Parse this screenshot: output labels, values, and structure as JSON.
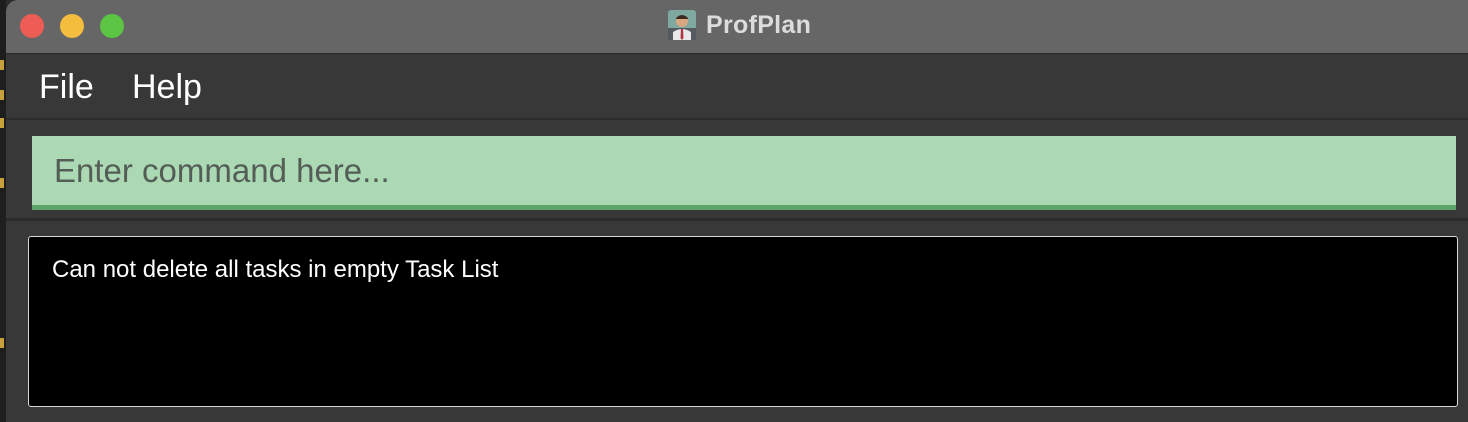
{
  "window": {
    "title": "ProfPlan",
    "app_icon": "professor-avatar-icon",
    "controls": [
      "close-icon",
      "minimize-icon",
      "zoom-icon"
    ]
  },
  "menu": {
    "items": [
      {
        "label": "File"
      },
      {
        "label": "Help"
      }
    ]
  },
  "command": {
    "placeholder": "Enter command here...",
    "value": ""
  },
  "result": {
    "message": "Can not delete all tasks in empty Task List"
  },
  "colors": {
    "titlebar": "#666666",
    "window_bg": "#383838",
    "command_box": "#aad9b4",
    "command_underline": "#5ba56a",
    "result_bg": "#000000",
    "close": "#ee5d55",
    "minimize": "#f4bd3e",
    "zoom": "#5cc543"
  }
}
